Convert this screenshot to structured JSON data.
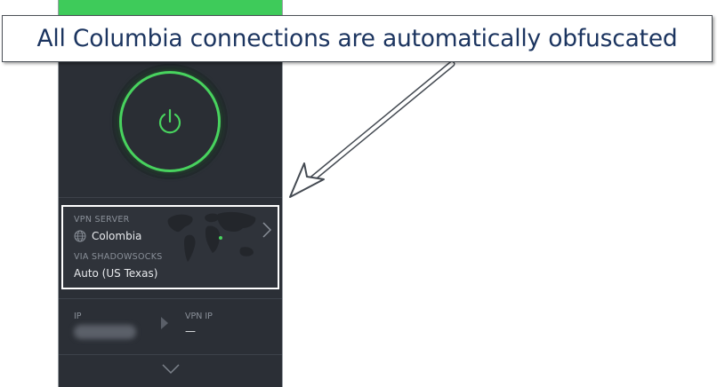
{
  "annotation": {
    "text": "All Columbia connections are automatically obfuscated",
    "text_color": "#1c3560"
  },
  "app": {
    "status_color": "#3ecb5a",
    "power_button_icon": "power-icon",
    "server": {
      "label": "VPN SERVER",
      "name": "Colombia",
      "icon": "globe-icon",
      "via_label": "VIA SHADOWSOCKS",
      "via_value": "Auto (US Texas)"
    },
    "ip": {
      "label": "IP",
      "vpn_label": "VPN IP",
      "vpn_value": "—"
    }
  }
}
